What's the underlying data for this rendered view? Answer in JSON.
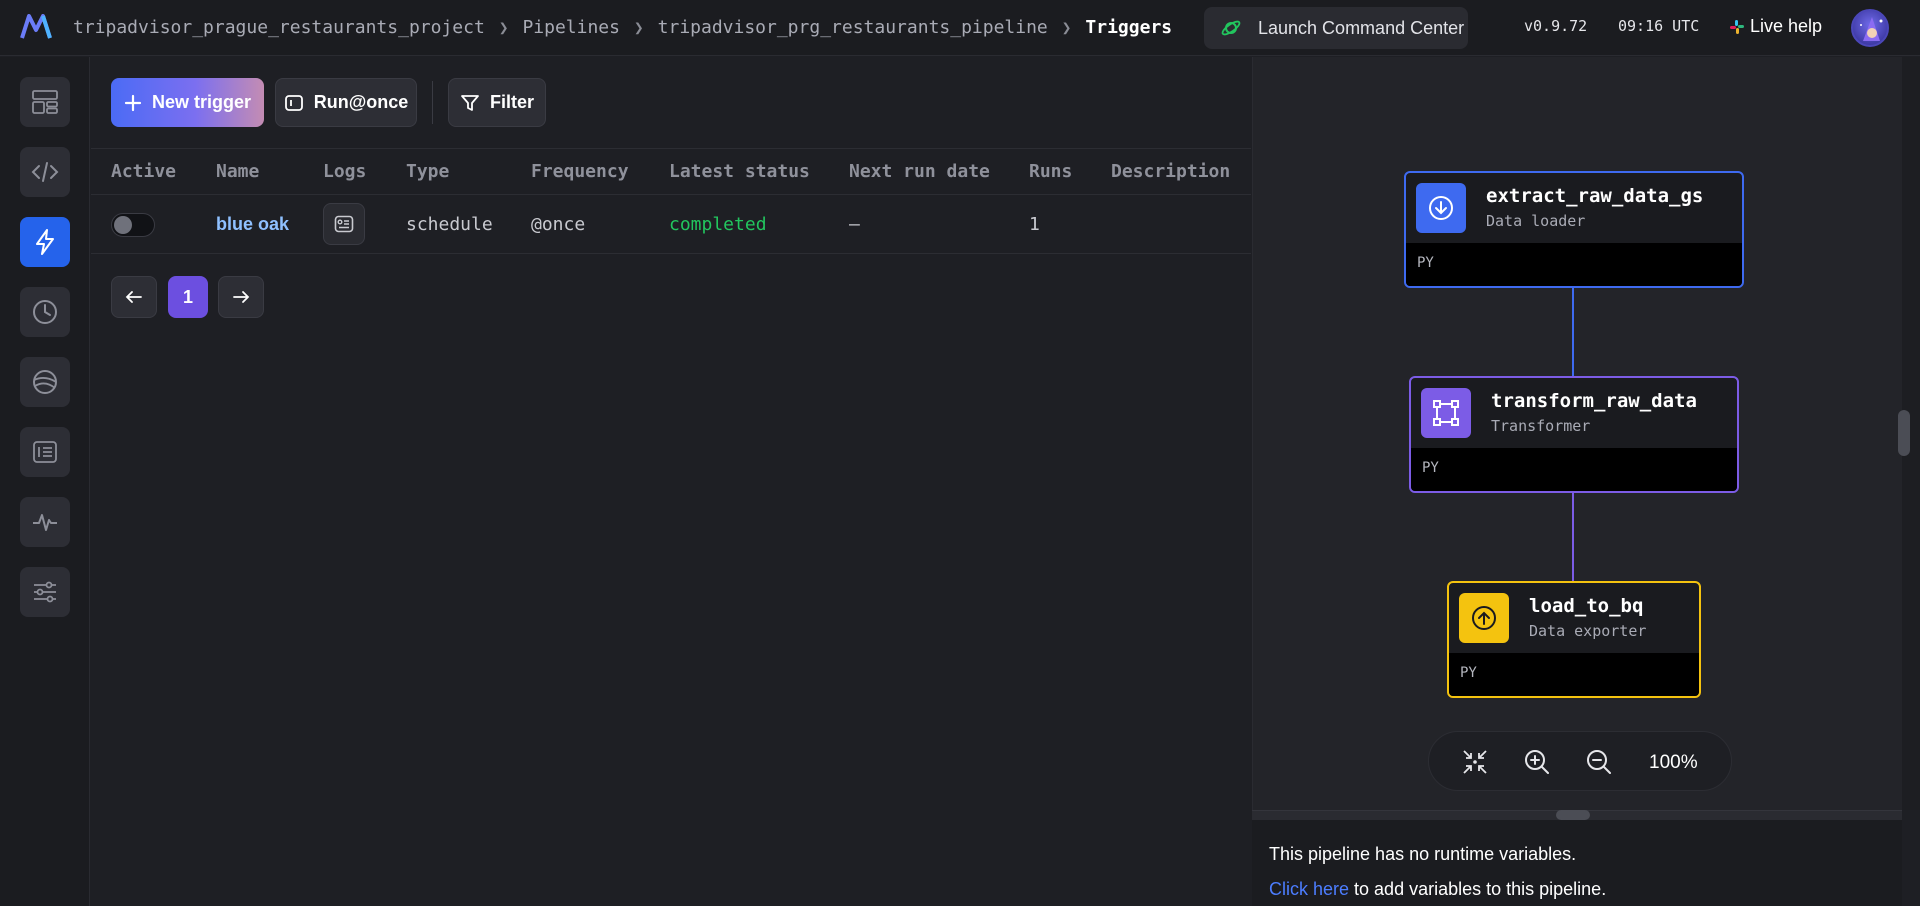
{
  "header": {
    "breadcrumb": {
      "project": "tripadvisor_prague_restaurants_project",
      "pipelines": "Pipelines",
      "pipeline": "tripadvisor_prg_restaurants_pipeline",
      "current": "Triggers"
    },
    "launch_command_center": "Launch Command Center",
    "version": "v0.9.72",
    "time": "09:16 UTC",
    "live_help": "Live help"
  },
  "sidebar": {
    "items": [
      {
        "icon": "dashboard-icon",
        "active": false
      },
      {
        "icon": "code-icon",
        "active": false
      },
      {
        "icon": "lightning-icon",
        "active": true
      },
      {
        "icon": "clock-icon",
        "active": false
      },
      {
        "icon": "planet-icon",
        "active": false
      },
      {
        "icon": "terminal-icon",
        "active": false
      },
      {
        "icon": "pulse-icon",
        "active": false
      },
      {
        "icon": "settings-sliders-icon",
        "active": false
      }
    ]
  },
  "toolbar": {
    "new_trigger": "New trigger",
    "run_once": "Run@once",
    "filter": "Filter"
  },
  "table": {
    "columns": [
      "Active",
      "Name",
      "Logs",
      "Type",
      "Frequency",
      "Latest status",
      "Next run date",
      "Runs",
      "Description"
    ],
    "rows": [
      {
        "active": false,
        "name": "blue oak",
        "type": "schedule",
        "frequency": "@once",
        "latest_status": "completed",
        "next_run_date": "—",
        "runs": "1",
        "description": ""
      }
    ]
  },
  "pagination": {
    "current_page": "1"
  },
  "graph": {
    "blocks": [
      {
        "name": "extract_raw_data_gs",
        "type": "Data loader",
        "lang": "PY",
        "color": "#3e6af0"
      },
      {
        "name": "transform_raw_data",
        "type": "Transformer",
        "lang": "PY",
        "color": "#7c5ce6"
      },
      {
        "name": "load_to_bq",
        "type": "Data exporter",
        "lang": "PY",
        "color": "#f4c30f"
      }
    ],
    "zoom": "100%"
  },
  "variables": {
    "message": "This pipeline has no runtime variables.",
    "link_text": "Click here",
    "link_suffix": " to add variables to this pipeline."
  }
}
